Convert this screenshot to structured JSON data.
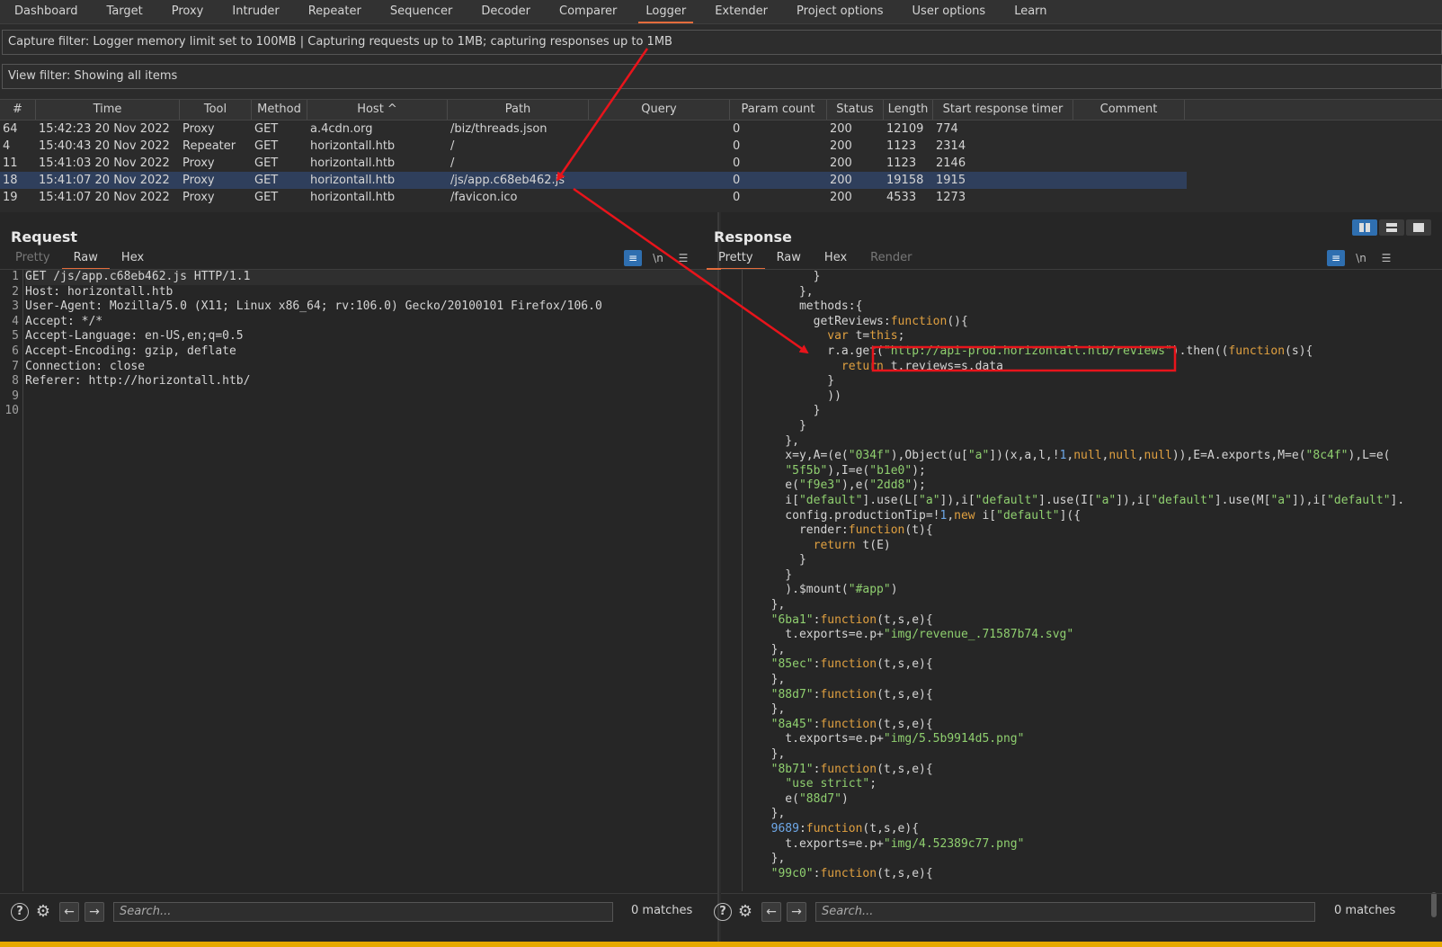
{
  "top_tabs": [
    "Dashboard",
    "Target",
    "Proxy",
    "Intruder",
    "Repeater",
    "Sequencer",
    "Decoder",
    "Comparer",
    "Logger",
    "Extender",
    "Project options",
    "User options",
    "Learn"
  ],
  "capture_filter": "Capture filter: Logger memory limit set to 100MB | Capturing requests up to 1MB;  capturing responses up to 1MB",
  "view_filter": "View filter: Showing all items",
  "table": {
    "headers": [
      "#",
      "Time",
      "Tool",
      "Method",
      "Host ^",
      "Path",
      "Query",
      "Param count",
      "Status",
      "Length",
      "Start response timer",
      "Comment"
    ],
    "rows": [
      [
        "64",
        "15:42:23 20 Nov 2022",
        "Proxy",
        "GET",
        "a.4cdn.org",
        "/biz/threads.json",
        "",
        "0",
        "200",
        "12109",
        "774",
        ""
      ],
      [
        "4",
        "15:40:43 20 Nov 2022",
        "Repeater",
        "GET",
        "horizontall.htb",
        "/",
        "",
        "0",
        "200",
        "1123",
        "2314",
        ""
      ],
      [
        "11",
        "15:41:03 20 Nov 2022",
        "Proxy",
        "GET",
        "horizontall.htb",
        "/",
        "",
        "0",
        "200",
        "1123",
        "2146",
        ""
      ],
      [
        "18",
        "15:41:07 20 Nov 2022",
        "Proxy",
        "GET",
        "horizontall.htb",
        "/js/app.c68eb462.js",
        "",
        "0",
        "200",
        "19158",
        "1915",
        ""
      ],
      [
        "19",
        "15:41:07 20 Nov 2022",
        "Proxy",
        "GET",
        "horizontall.htb",
        "/favicon.ico",
        "",
        "0",
        "200",
        "4533",
        "1273",
        ""
      ]
    ]
  },
  "request": {
    "title": "Request",
    "tabs": [
      "Pretty",
      "Raw",
      "Hex"
    ],
    "newline_toggle": "\\n",
    "lines": [
      "GET /js/app.c68eb462.js HTTP/1.1",
      "Host: horizontall.htb",
      "User-Agent: Mozilla/5.0 (X11; Linux x86_64; rv:106.0) Gecko/20100101 Firefox/106.0",
      "Accept: */*",
      "Accept-Language: en-US,en;q=0.5",
      "Accept-Encoding: gzip, deflate",
      "Connection: close",
      "Referer: http://horizontall.htb/",
      "",
      ""
    ],
    "search_placeholder": "Search...",
    "matches": "0 matches"
  },
  "response": {
    "title": "Response",
    "tabs": [
      "Pretty",
      "Raw",
      "Hex",
      "Render"
    ],
    "newline_toggle": "\\n",
    "search_placeholder": "Search...",
    "matches": "0 matches"
  },
  "colors": {
    "accent_tab": "#e46c3c",
    "selected_row": "#2f3f5c",
    "annotation_red": "#e8141b",
    "string_green": "#8fcf6f",
    "keyword_orange": "#e0a040",
    "number_blue": "#6ea8e8"
  }
}
